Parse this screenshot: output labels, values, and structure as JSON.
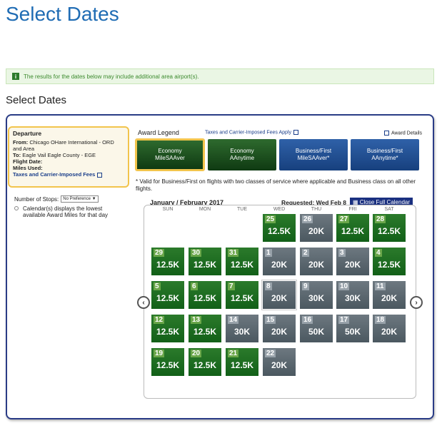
{
  "page_title": "Select Dates",
  "notice": {
    "icon": "info-icon",
    "text": "The results for the dates below may include additional area airport(s)."
  },
  "sub_title": "Select Dates",
  "departure": {
    "title": "Departure",
    "from_label": "From:",
    "from_value": "Chicago OHare International - ORD and Area",
    "to_label": "To:",
    "to_value": "Eagle Vail Eagle County - EGE",
    "flight_date_label": "Flight Date:",
    "miles_used_label": "Miles Used:",
    "fees_link": "Taxes and Carrier-Imposed Fees"
  },
  "stops": {
    "label": "Number of Stops:",
    "value": "No Preference"
  },
  "calendar_note": "Calendar(s) displays the lowest available Award Miles for that day",
  "legend": {
    "label": "Award Legend",
    "taxes_link": "Taxes and Carrier-Imposed Fees Apply",
    "details_link": "Award Details",
    "buttons": [
      {
        "line1": "Economy",
        "line2": "MileSAAver",
        "color": "#1f5a22"
      },
      {
        "line1": "Economy",
        "line2": "AAnytime",
        "color": "#1f5a22"
      },
      {
        "line1": "Business/First",
        "line2": "MileSAAver*",
        "color": "#2451a0"
      },
      {
        "line1": "Business/First",
        "line2": "AAnytime*",
        "color": "#2451a0"
      }
    ]
  },
  "valid_note": "* Valid for Business/First on flights with two classes of service where applicable and Business class on all other flights.",
  "calendar": {
    "month": "January / February 2017",
    "requested": "Requested: Wed Feb 8",
    "close_label": "Close Full Calendar",
    "weekdays": [
      "SUN",
      "MON",
      "TUE",
      "WED",
      "THU",
      "FRI",
      "SAT"
    ],
    "days": [
      {
        "day": "25",
        "miles": "12.5K",
        "type": "green"
      },
      {
        "day": "26",
        "miles": "20K",
        "type": "gray"
      },
      {
        "day": "27",
        "miles": "12.5K",
        "type": "green"
      },
      {
        "day": "28",
        "miles": "12.5K",
        "type": "green"
      },
      {
        "day": "29",
        "miles": "12.5K",
        "type": "green"
      },
      {
        "day": "30",
        "miles": "12.5K",
        "type": "green"
      },
      {
        "day": "31",
        "miles": "12.5K",
        "type": "green"
      },
      {
        "day": "1",
        "miles": "20K",
        "type": "gray"
      },
      {
        "day": "2",
        "miles": "20K",
        "type": "gray"
      },
      {
        "day": "3",
        "miles": "20K",
        "type": "gray"
      },
      {
        "day": "4",
        "miles": "12.5K",
        "type": "green"
      },
      {
        "day": "5",
        "miles": "12.5K",
        "type": "green"
      },
      {
        "day": "6",
        "miles": "12.5K",
        "type": "green"
      },
      {
        "day": "7",
        "miles": "12.5K",
        "type": "green"
      },
      {
        "day": "8",
        "miles": "20K",
        "type": "gray"
      },
      {
        "day": "9",
        "miles": "30K",
        "type": "gray"
      },
      {
        "day": "10",
        "miles": "30K",
        "type": "gray"
      },
      {
        "day": "11",
        "miles": "20K",
        "type": "gray"
      },
      {
        "day": "12",
        "miles": "12.5K",
        "type": "green"
      },
      {
        "day": "13",
        "miles": "12.5K",
        "type": "green"
      },
      {
        "day": "14",
        "miles": "30K",
        "type": "gray"
      },
      {
        "day": "15",
        "miles": "20K",
        "type": "gray"
      },
      {
        "day": "16",
        "miles": "50K",
        "type": "gray"
      },
      {
        "day": "17",
        "miles": "50K",
        "type": "gray"
      },
      {
        "day": "18",
        "miles": "20K",
        "type": "gray"
      },
      {
        "day": "19",
        "miles": "12.5K",
        "type": "green"
      },
      {
        "day": "20",
        "miles": "12.5K",
        "type": "green"
      },
      {
        "day": "21",
        "miles": "12.5K",
        "type": "green"
      },
      {
        "day": "22",
        "miles": "20K",
        "type": "gray"
      }
    ]
  }
}
